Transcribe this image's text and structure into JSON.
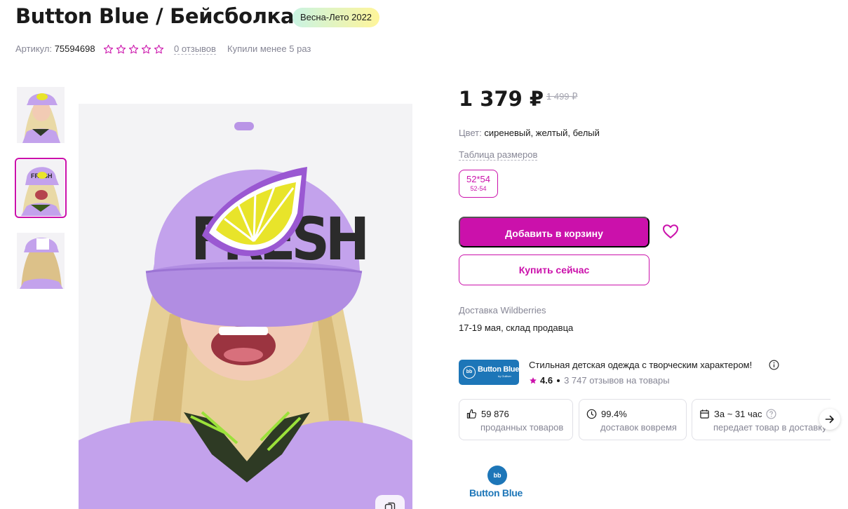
{
  "product": {
    "title": "Button Blue / Бейсболка",
    "season_badge": "Весна-Лето 2022",
    "article_label": "Артикул:",
    "article_value": "75594698",
    "rating_stars_filled": 0,
    "rating_stars_total": 5,
    "reviews_link": "0 отзывов",
    "bought_text": "Купили менее 5 раз"
  },
  "gallery": {
    "thumbnails": [
      {
        "name": "thumb-1",
        "active": false
      },
      {
        "name": "thumb-2",
        "active": true
      },
      {
        "name": "thumb-3",
        "active": false
      }
    ],
    "main_image_caption": "FRESH"
  },
  "pricing": {
    "price": "1 379 ₽",
    "old_price": "1 499 ₽"
  },
  "color": {
    "label": "Цвет:",
    "value": "сиреневый, желтый, белый"
  },
  "sizes": {
    "table_link": "Таблица размеров",
    "options": [
      {
        "main": "52*54",
        "sub": "52-54",
        "selected": true
      }
    ]
  },
  "actions": {
    "add_to_cart": "Добавить в корзину",
    "buy_now": "Купить сейчас"
  },
  "delivery": {
    "label": "Доставка Wildberries",
    "value": "17-19 мая, склад продавца"
  },
  "seller": {
    "logo_text": "Button Blue",
    "logo_mark": "bb",
    "logo_sub": "by Gulliver",
    "description": "Стильная детская одежда с творческим характером!",
    "rating": "4.6",
    "reviews": "3 747 отзывов на товары"
  },
  "stats": [
    {
      "icon": "thumbs-up-icon",
      "value": "59 876",
      "label": "проданных товаров"
    },
    {
      "icon": "clock-icon",
      "value": "99.4%",
      "label": "доставок вовремя"
    },
    {
      "icon": "calendar-icon",
      "value": "За ~ 31 час",
      "label": "передает товар в доставку"
    }
  ],
  "brand": {
    "name": "Button Blue",
    "mark": "bb"
  },
  "colors": {
    "accent": "#cb11ab",
    "brand_blue": "#1d76b8",
    "muted_text": "#868695",
    "lilac": "#c3a2ec",
    "lemon": "#e8e42a"
  }
}
